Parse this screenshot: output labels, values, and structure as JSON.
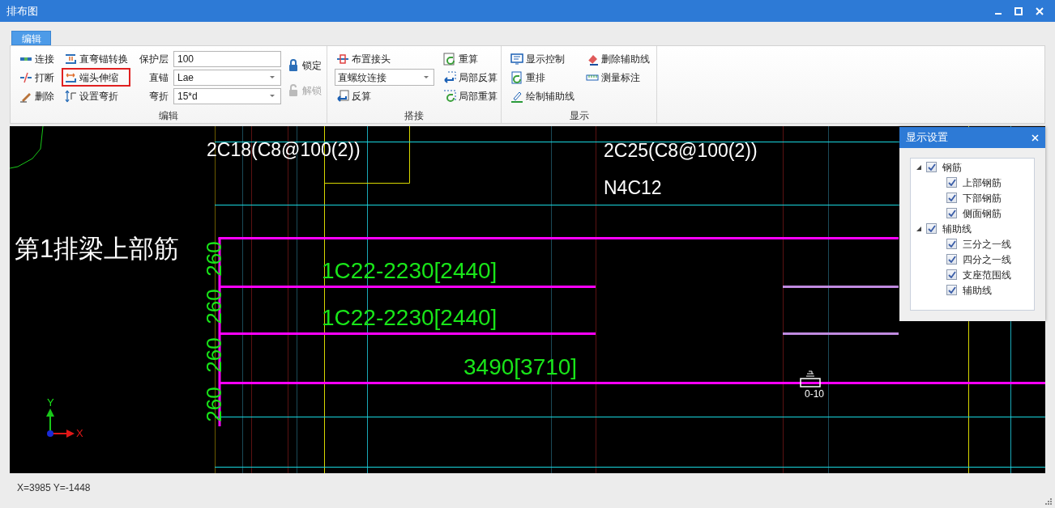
{
  "window": {
    "title": "排布图"
  },
  "ribbon": {
    "tabs": [
      {
        "label": "编辑",
        "selected": true
      }
    ],
    "groups": [
      {
        "label": "编辑",
        "buttons": [
          {
            "label": "连接",
            "highlighted": false
          },
          {
            "label": "打断",
            "highlighted": false
          },
          {
            "label": "删除",
            "highlighted": false
          },
          {
            "label": "直弯锚转换",
            "highlighted": false
          },
          {
            "label": "端头伸缩",
            "highlighted": true
          },
          {
            "label": "设置弯折",
            "highlighted": false
          }
        ],
        "fields": [
          {
            "label": "保护层",
            "kind": "text",
            "value": "100"
          },
          {
            "label": "直锚",
            "kind": "dropdown",
            "value": "Lae"
          },
          {
            "label": "弯折",
            "kind": "dropdown",
            "value": "15*d"
          }
        ],
        "locks": [
          {
            "label": "锁定",
            "disabled": false
          },
          {
            "label": "解锁",
            "disabled": true
          }
        ]
      },
      {
        "label": "搭接",
        "buttons": [
          {
            "label": "布置接头"
          },
          {
            "label": "反算"
          },
          {
            "label": "重算"
          },
          {
            "label": "局部反算"
          },
          {
            "label": "局部重算"
          }
        ],
        "dropdown": {
          "value": "直螺纹连接"
        }
      },
      {
        "label": "显示",
        "buttons": [
          {
            "label": "显示控制"
          },
          {
            "label": "重排"
          },
          {
            "label": "绘制辅助线"
          },
          {
            "label": "删除辅助线"
          },
          {
            "label": "测量标注"
          }
        ]
      }
    ]
  },
  "canvas": {
    "labels": [
      {
        "text": "2C18(C8@100(2))",
        "kind": "note"
      },
      {
        "text": "2C25(C8@100(2))",
        "kind": "note"
      },
      {
        "text": "N4C12",
        "kind": "note"
      },
      {
        "text": "第1排梁上部筋",
        "kind": "title"
      },
      {
        "text": "260",
        "kind": "dimension"
      },
      {
        "text": "260",
        "kind": "dimension"
      },
      {
        "text": "260",
        "kind": "dimension"
      },
      {
        "text": "260",
        "kind": "dimension"
      },
      {
        "text": "1C22-2230[2440]",
        "kind": "rebar"
      },
      {
        "text": "1C22-2230[2440]",
        "kind": "rebar"
      },
      {
        "text": "3490[3710]",
        "kind": "rebar"
      },
      {
        "text": "0-10",
        "kind": "marker"
      }
    ],
    "axes": {
      "x_label": "X",
      "y_label": "Y"
    }
  },
  "display_settings": {
    "title": "显示设置",
    "tree": [
      {
        "label": "钢筋",
        "checked": true,
        "expanded": true,
        "children": [
          {
            "label": "上部钢筋",
            "checked": true
          },
          {
            "label": "下部钢筋",
            "checked": true
          },
          {
            "label": "侧面钢筋",
            "checked": true
          }
        ]
      },
      {
        "label": "辅助线",
        "checked": true,
        "expanded": true,
        "children": [
          {
            "label": "三分之一线",
            "checked": true
          },
          {
            "label": "四分之一线",
            "checked": true
          },
          {
            "label": "支座范围线",
            "checked": true
          },
          {
            "label": "辅助线",
            "checked": true
          }
        ]
      }
    ]
  },
  "status_bar": {
    "coordinates": "X=3985 Y=-1448"
  }
}
